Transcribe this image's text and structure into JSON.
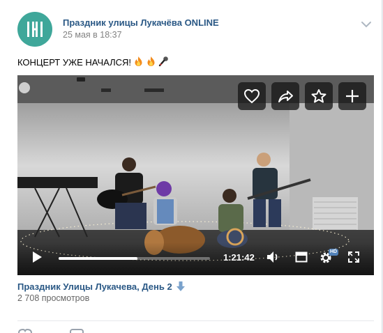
{
  "post": {
    "author": "Праздник улицы Лукачёва ONLINE",
    "date": "25 мая в 18:37",
    "text": "КОНЦЕРТ УЖЕ НАЧАЛСЯ!",
    "emojis": [
      "fire-emoji",
      "fire-emoji",
      "microphone-emoji"
    ]
  },
  "video": {
    "title": "Праздник Улицы Лукачева, День 2",
    "views": "2 708 просмотров",
    "time": "1:21:42",
    "progress": 0.52,
    "quality_badge": "HD",
    "actions": [
      "heart-icon",
      "share-icon",
      "star-icon",
      "plus-icon"
    ],
    "controls": [
      "play-icon",
      "volume-icon",
      "miniplayer-icon",
      "settings-icon",
      "fullscreen-icon"
    ]
  },
  "colors": {
    "link": "#2a5885",
    "avatar": "#3fa79a",
    "accent": "#5181b8"
  }
}
